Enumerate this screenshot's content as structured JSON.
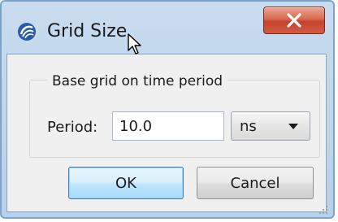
{
  "window": {
    "title": "Grid Size",
    "icon": "app-icon",
    "close_icon": "close-icon"
  },
  "group": {
    "label": "Base grid on time period"
  },
  "period": {
    "label": "Period:",
    "value": "10.0",
    "unit": "ns"
  },
  "buttons": {
    "ok": "OK",
    "cancel": "Cancel"
  },
  "colors": {
    "close_button": "#d45b43",
    "ok_button_border": "#3c7fb1",
    "frame": "#b7cfe8"
  }
}
